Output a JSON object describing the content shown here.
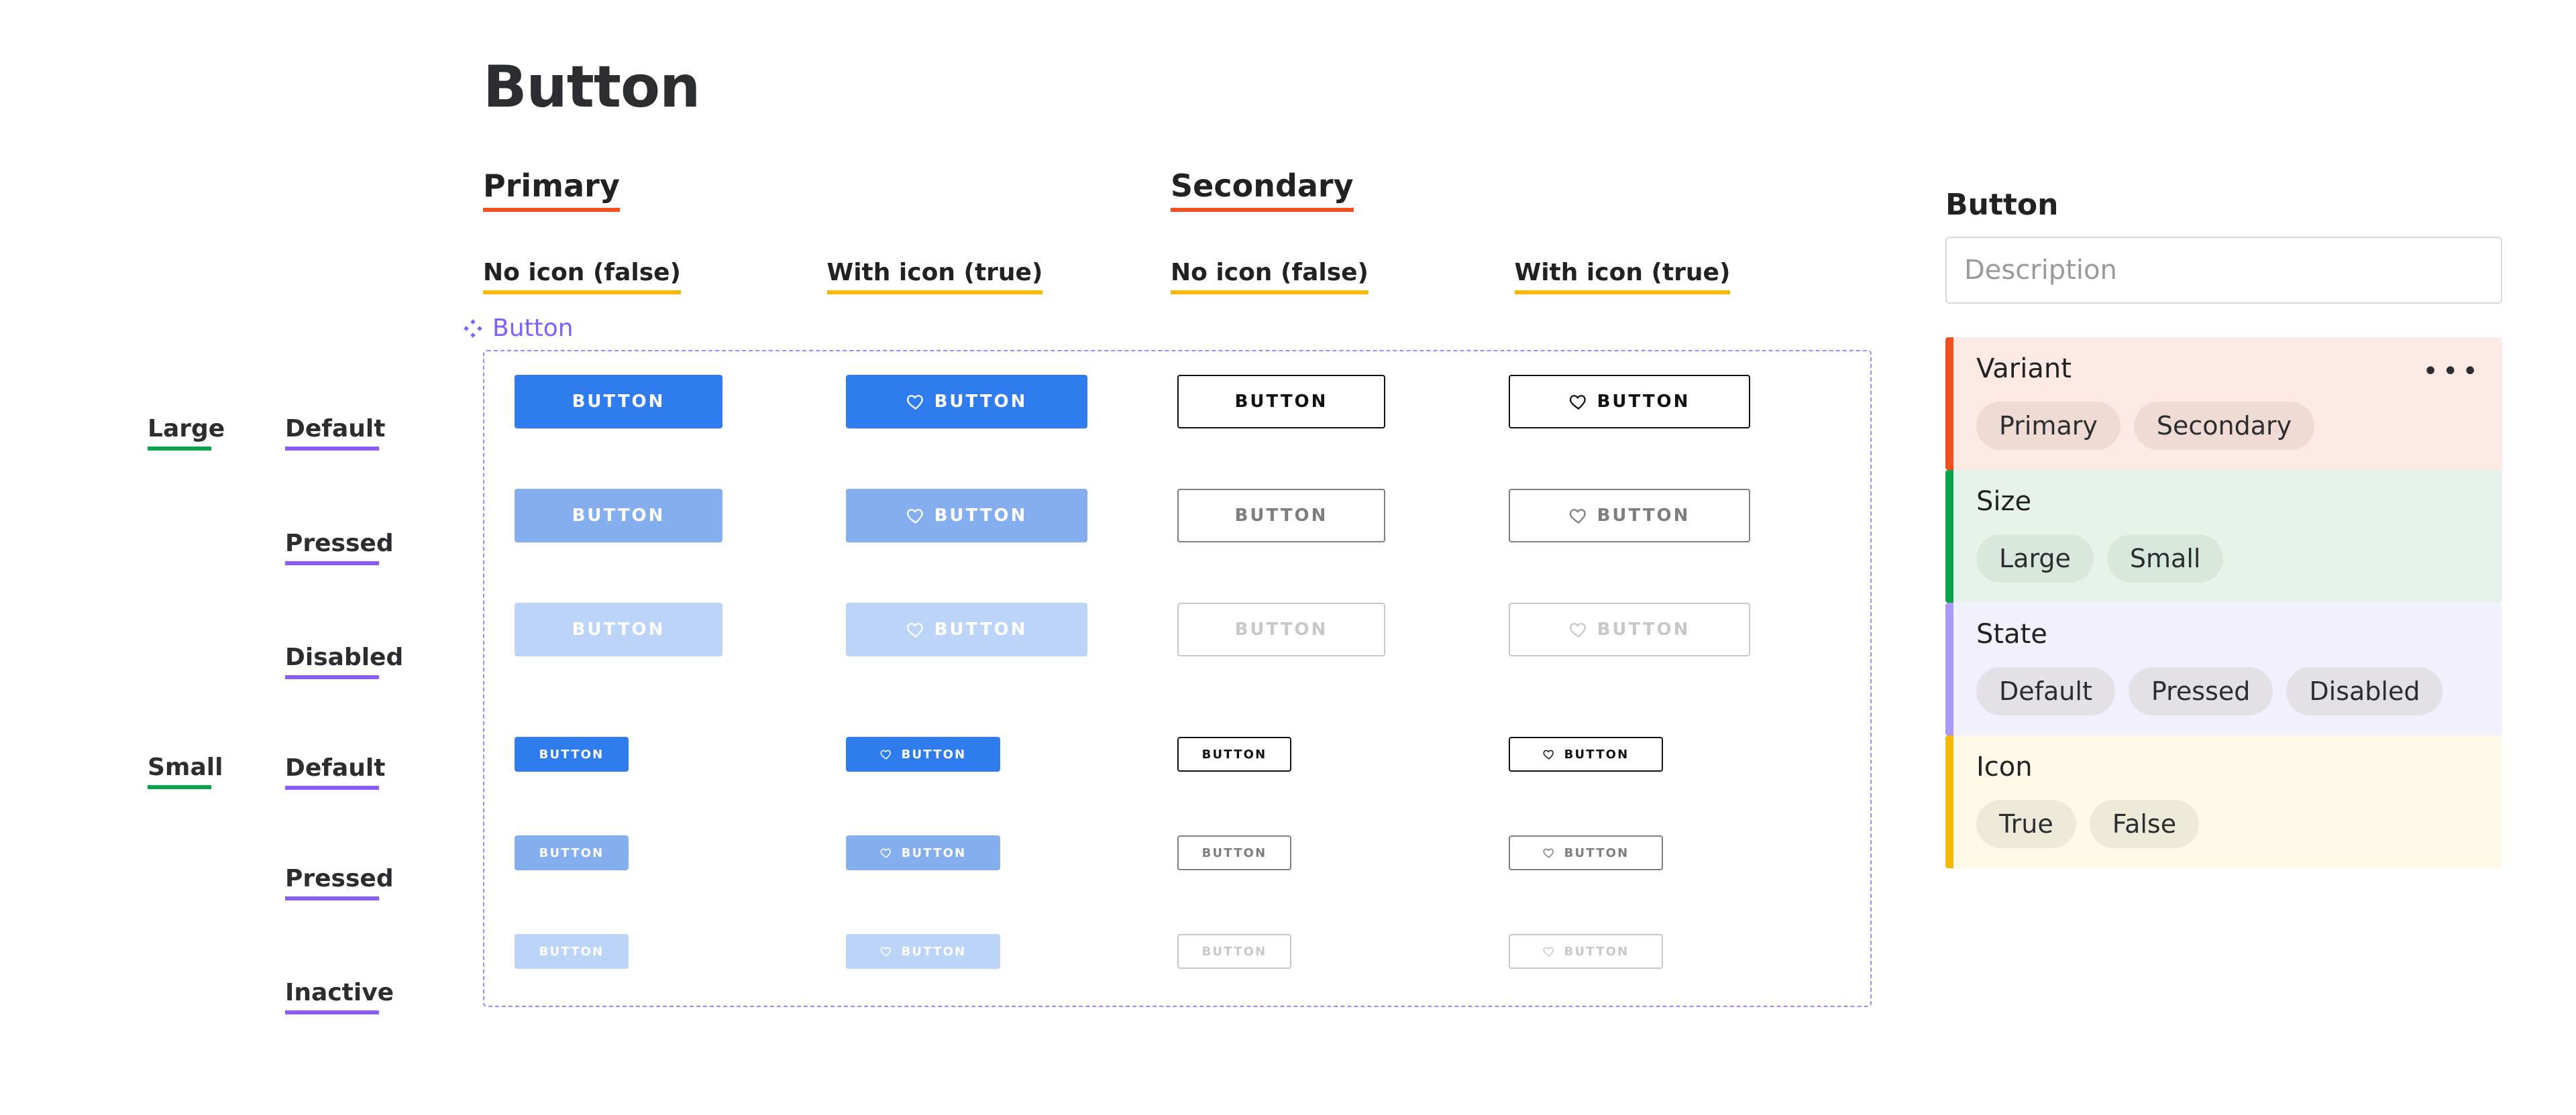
{
  "title": "Button",
  "variant_headers": {
    "primary": "Primary",
    "secondary": "Secondary",
    "no_icon": "No icon (false)",
    "with_icon": "With icon (true)"
  },
  "component_label": "Button",
  "size_labels": {
    "large": "Large",
    "small": "Small"
  },
  "state_labels": {
    "default": "Default",
    "pressed": "Pressed",
    "disabled": "Disabled",
    "inactive": "Inactive"
  },
  "button_label": "BUTTON",
  "panel": {
    "title": "Button",
    "description_placeholder": "Description",
    "groups": {
      "variant": {
        "label": "Variant",
        "options": [
          "Primary",
          "Secondary"
        ]
      },
      "size": {
        "label": "Size",
        "options": [
          "Large",
          "Small"
        ]
      },
      "state": {
        "label": "State",
        "options": [
          "Default",
          "Pressed",
          "Disabled"
        ]
      },
      "icon": {
        "label": "Icon",
        "options": [
          "True",
          "False"
        ]
      }
    }
  },
  "colors": {
    "primary_default": "#2f7cee",
    "primary_pressed": "#84aeee",
    "primary_disabled": "#bcd4f7",
    "accent_orange": "#f24e1e",
    "accent_green": "#0aa24a",
    "accent_purple": "#8a5cf6",
    "accent_amber": "#f7b900"
  }
}
